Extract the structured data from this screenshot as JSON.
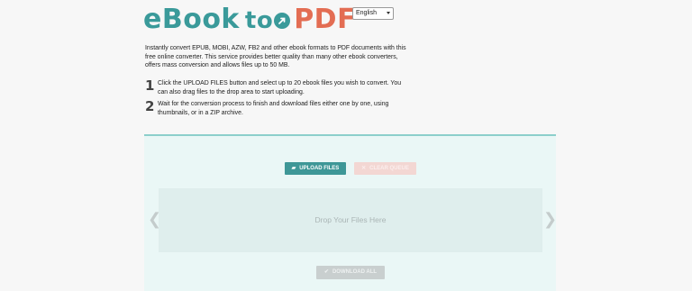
{
  "header": {
    "logo_part1": "eBook",
    "logo_part2": "to",
    "logo_part3": "PDF",
    "language_selected": "English"
  },
  "intro": "Instantly convert EPUB, MOBI, AZW, FB2 and other ebook formats to PDF documents with this free online converter. This service provides better quality than many other ebook converters, offers mass conversion and allows files up to 50 MB.",
  "steps": [
    {
      "num": "1",
      "text": "Click the UPLOAD FILES button and select up to 20 ebook files you wish to convert. You can also drag files to the drop area to start uploading."
    },
    {
      "num": "2",
      "text": "Wait for the conversion process to finish and download files either one by one, using thumbnails, or in a ZIP archive."
    }
  ],
  "panel": {
    "upload_label": "UPLOAD FILES",
    "clear_label": "CLEAR QUEUE",
    "drop_label": "Drop Your Files Here",
    "download_label": "DOWNLOAD ALL",
    "prev_arrow": "❮",
    "next_arrow": "❯"
  },
  "colors": {
    "accent": "#3e9797",
    "logo_teal": "#3a9a9a",
    "logo_orange": "#e36d53",
    "panel_bg": "#eaf7f6"
  }
}
